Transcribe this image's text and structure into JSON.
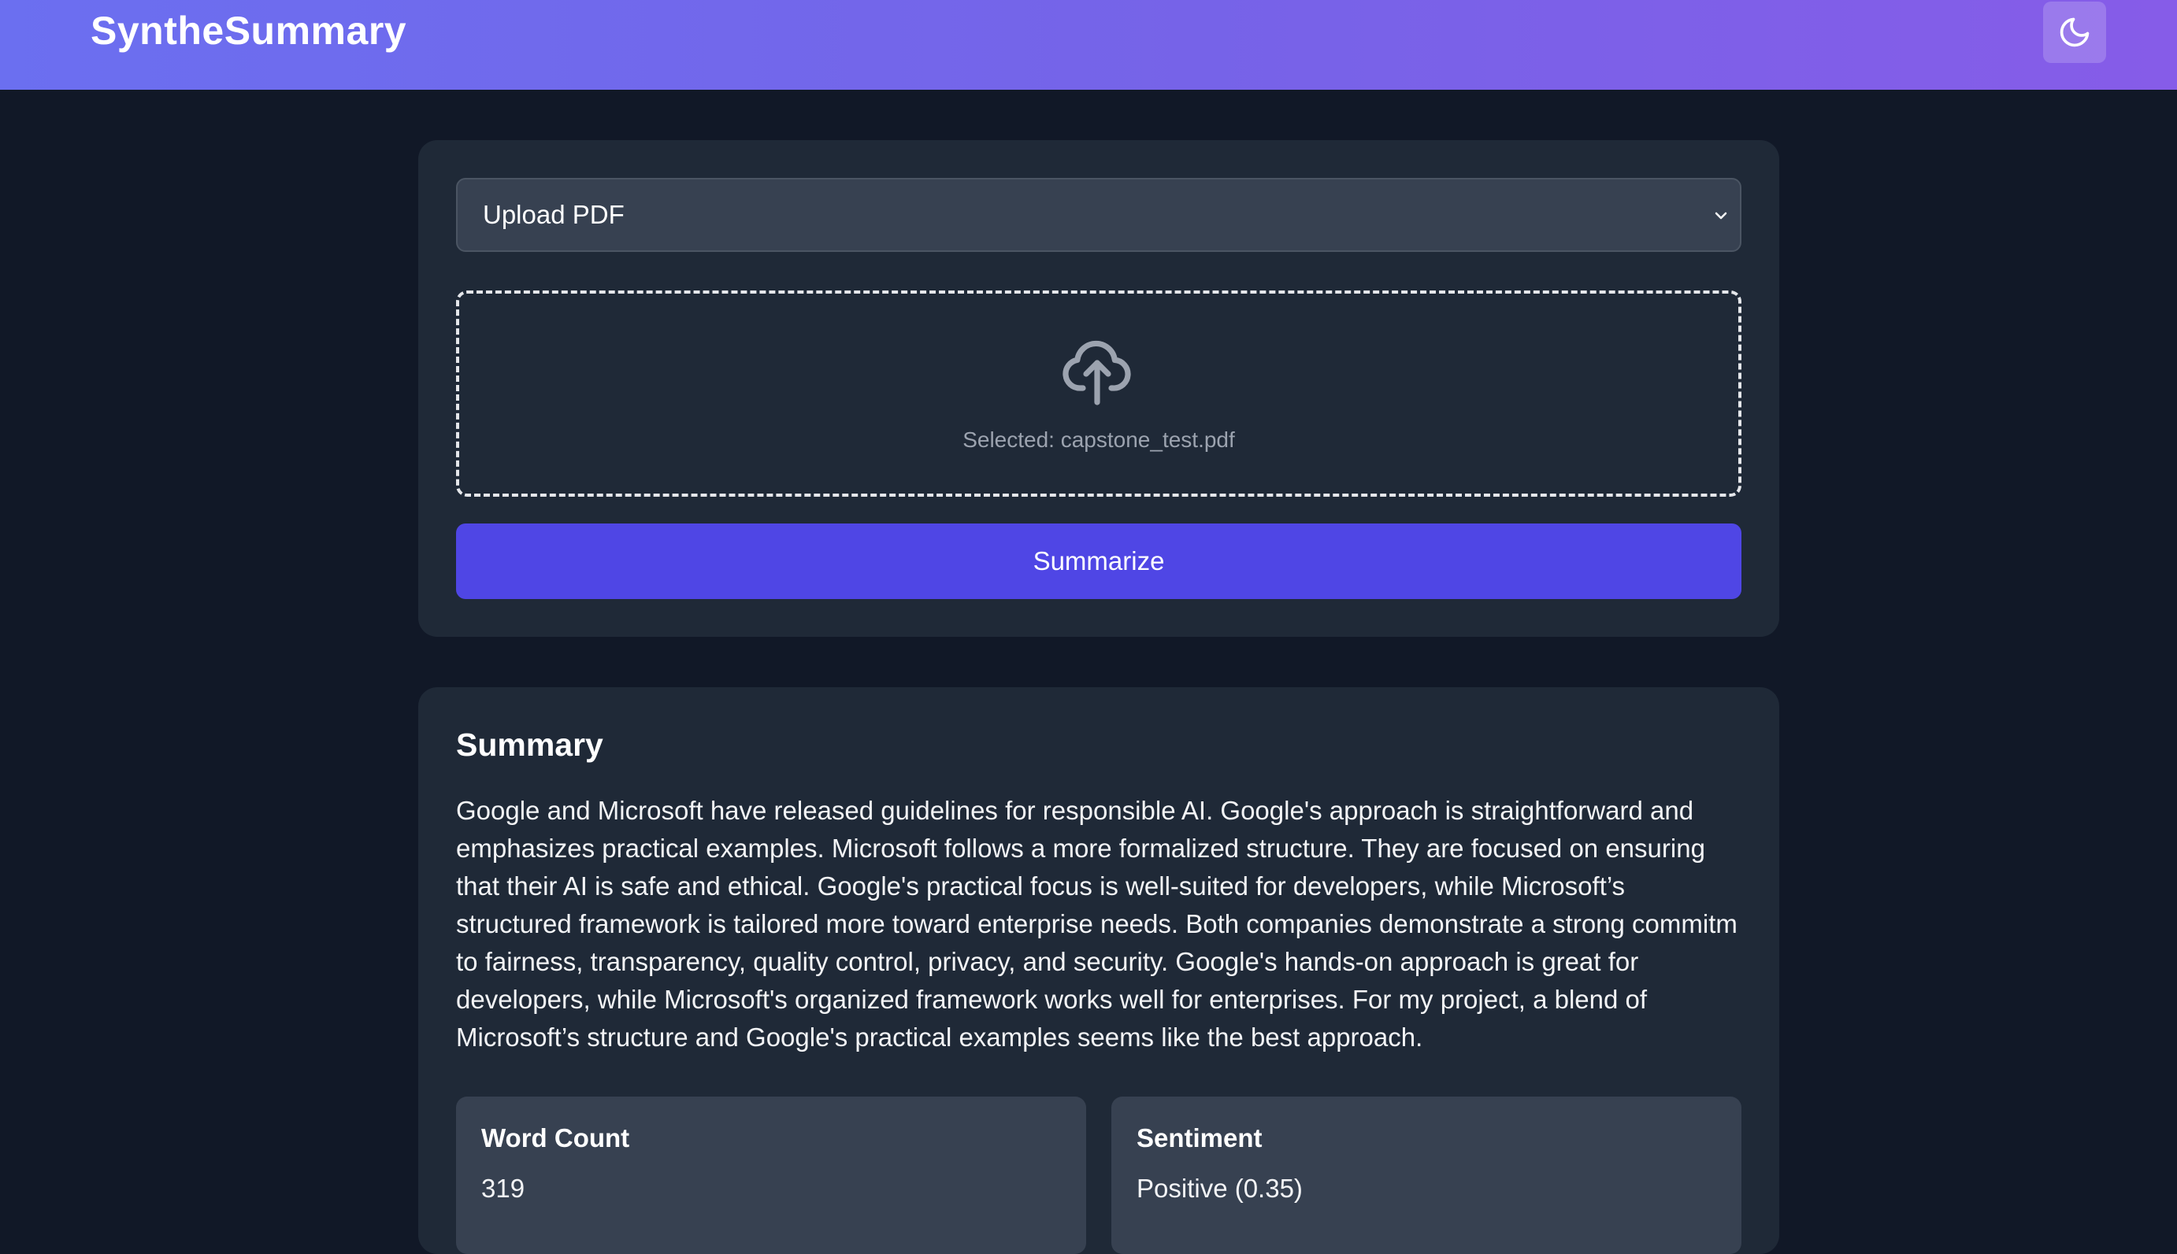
{
  "header": {
    "brand": "SyntheSummary",
    "theme_toggle_icon": "moon-icon",
    "gradient_start": "#6b6ff0",
    "gradient_end": "#865ce8"
  },
  "upload": {
    "source_select_value": "Upload PDF",
    "dropzone_icon": "cloud-upload-icon",
    "selected_file_text": "Selected: capstone_test.pdf",
    "summarize_label": "Summarize",
    "accent_color": "#4f46e5"
  },
  "summary": {
    "title": "Summary",
    "text": "Google and Microsoft have released guidelines for responsible AI. Google's approach is straightforward and emphasizes practical examples. Microsoft follows a more formalized structure. They are focused on ensuring that their AI is safe and ethical. Google's practical focus is well-suited for developers, while Microsoft’s structured framework is tailored more toward enterprise needs. Both companies demonstrate a strong commitm to fairness, transparency, quality control, privacy, and security. Google's hands-on approach is great for developers, while Microsoft's organized framework works well for enterprises. For my project, a blend of Microsoft’s structure and Google's practical examples seems like the best approach.",
    "stats": [
      {
        "label": "Word Count",
        "value": "319"
      },
      {
        "label": "Sentiment",
        "value": "Positive (0.35)"
      }
    ]
  }
}
